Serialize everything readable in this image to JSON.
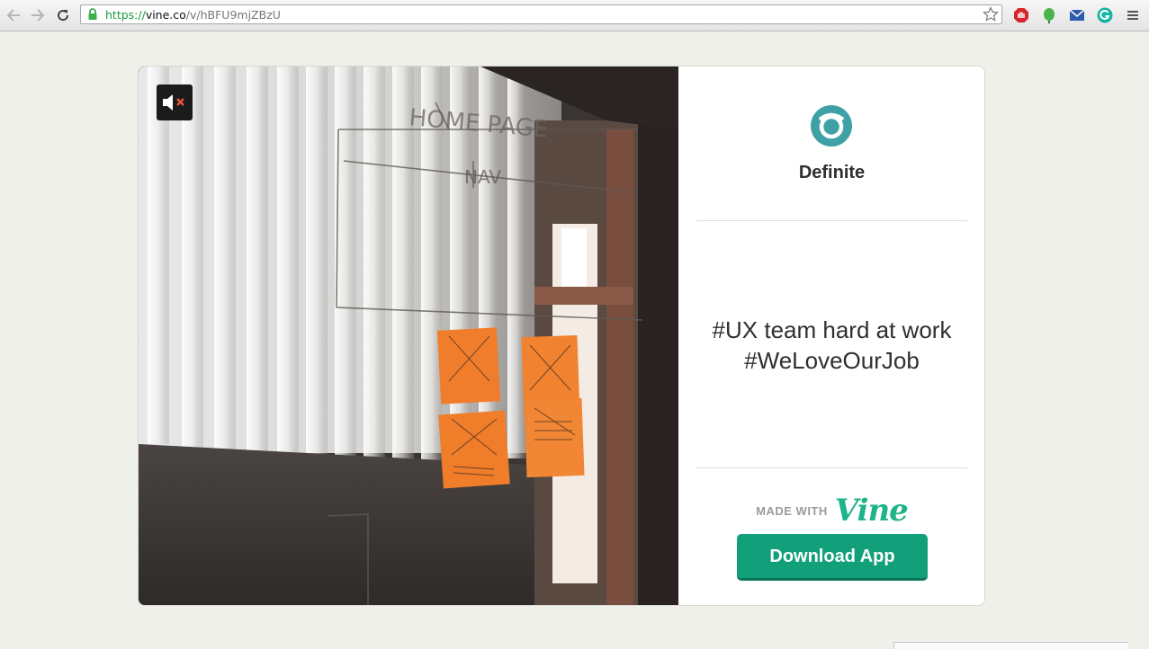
{
  "browser": {
    "url_scheme": "https://",
    "url_host": "vine.co",
    "url_path": "/v/hBFU9mjZBzU",
    "extensions": [
      "adblock-icon",
      "evernote-icon",
      "mail-icon",
      "grammarly-icon"
    ]
  },
  "post": {
    "profile_name": "Definite",
    "caption_line1": "#UX team hard at work",
    "caption_line2": "#WeLoveOurJob",
    "made_with_label": "MADE WITH",
    "brand_word": "Vine",
    "download_label": "Download App"
  },
  "colors": {
    "page_bg": "#f0f0eb",
    "vine_green": "#1fb389",
    "button_green": "#12a07a",
    "profile_teal": "#3fa1a5",
    "mute_x": "#e8543a"
  }
}
